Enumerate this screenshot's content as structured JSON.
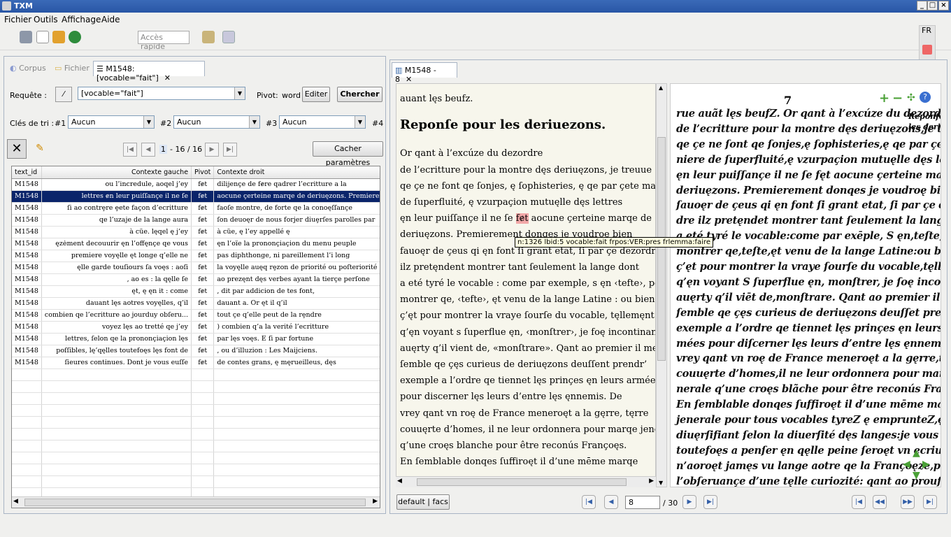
{
  "window": {
    "title": "TXM",
    "controls": [
      "_",
      "□",
      "×"
    ]
  },
  "menu": [
    "Fichier",
    "Outils",
    "Affichage",
    "Aide"
  ],
  "toolbar": {
    "quick_access_placeholder": "Accès rapide"
  },
  "lang": {
    "code": "FR"
  },
  "left_tabs": {
    "corpus": "Corpus",
    "fichier": "Fichier",
    "conc": "M1548:[vocable=\"fait\"]"
  },
  "query": {
    "label": "Requête :",
    "value": "[vocable=\"fait\"]",
    "pivot_label": "Pivot:",
    "pivot_value": "word",
    "edit": "Editer",
    "search": "Chercher"
  },
  "sort": {
    "label": "Clés de tri :",
    "k1": "#1",
    "k2": "#2",
    "k3": "#3",
    "k4": "#4",
    "v1": "Aucun",
    "v2": "Aucun",
    "v3": "Aucun"
  },
  "pager": {
    "current": "1",
    "total": "- 16 / 16",
    "hide": "Cacher paramètres"
  },
  "columns": [
    "text_id",
    "Contexte gauche",
    "Pivot",
    "Contexte droit"
  ],
  "rows": [
    [
      "M1548",
      "ou l’incredule, aoqel j’ey",
      "fɇt",
      "dilijençe de fɇre qadrer l’ecritture a la"
    ],
    [
      "M1548",
      "lettres ɇn leur puiſſançe il ne ſe",
      "fɇt",
      "aocune çerteine marqe de deriuęzons. Premiereme"
    ],
    [
      "M1548",
      "ſi ao contrȩre ȩete façon d’ecritture",
      "fɇt",
      "faoſe montre, de forte qe la conoęſſançe"
    ],
    [
      "M1548",
      "qe l’uzaje de la lange aura",
      "fɇt",
      "ſon deuoęr de nous forjer diuȩrſes parolles par"
    ],
    [
      "M1548",
      "à cüe. lęqel ę j’ey",
      "fɇt",
      "à cüe, ę l’ey appellé ę"
    ],
    [
      "M1548",
      "ęzėment decouurir ęn l’offęnçe qe vous",
      "fɇt",
      "ęn l’oïe la prononçiaçion du menu peuple"
    ],
    [
      "M1548",
      "premiere voyęlle ęt longe q’elle ne",
      "fɇt",
      "pas diphthonge, ni pareillement l’i long"
    ],
    [
      "M1548",
      "ęlle garde touſiours ſa voęs : aoſi",
      "fɇt",
      "la voyęlle auęq rȩzon de priorité ou poſteriorité"
    ],
    [
      "M1548",
      ", ao es : la qęlle ſe",
      "fɇt",
      "ao prezęnt dęs verbes ayant la tierçe perſone"
    ],
    [
      "M1548",
      "ęt, ę ęn it : come",
      "fɇt",
      ", dit par addicion de tes font,"
    ],
    [
      "M1548",
      "dauant lęs aotres voyęlles, q’il",
      "fɇt",
      "dauant a. Or ęt il q’il"
    ],
    [
      "M1548",
      "combien qe l’ecritture ao jourduy obſeru...",
      "fɇt",
      "tout çe q’elle peut de la rȩndre"
    ],
    [
      "M1548",
      "voyez lęs ao tretté qe j’ey",
      "fɇt",
      ") combien q’a la verité l’ecritture"
    ],
    [
      "M1548",
      "lettres, ſelon qe la prononçiaçion lęs",
      "fɇt",
      "par lęs voęs. E ſi par fortune"
    ],
    [
      "M1548",
      "poſſibles, lę’qęlles toutefoęs lęs font de",
      "fɇt",
      ", ou d’illuzion : Les Maijciens."
    ],
    [
      "M1548",
      "ſieures continues. Dont je vous euſſe",
      "fɇt",
      "de contes grans, ę męrueilleus, dęs"
    ]
  ],
  "right_tab": {
    "label": "M1548 - 8"
  },
  "text": {
    "first": "auant lęs beufz.",
    "heading": "Reponſe pour les deriuezons.",
    "lines": [
      " Or qant à l’excúze du dezordre",
      "de l’ecritture pour la montre dęs deriuęzons, je treuue",
      "qe çe ne font qe ſonjes, ę ſophisteries, ę qe par çete manier",
      "de ſuperfluité, ę vzurpaçion mutuęlle dęs lettres",
      "ęn leur puiſſançe il ne ſe ",
      "deriuęzons. Premierement donges je voudroę bien",
      "fauoęr de çeus qi ęn font ſi grant etat, ſi par çe dezordre",
      "ilz pretęndent montrer tant ſeulement la lange dont",
      "a eté tyré le vocable : come par exemple, s ęn ‹tefte›, pour",
      "montrer qe, ‹tefte›, ęt venu de la lange Latine : ou bien ſi",
      "ç’ęt pour montrer la vraye ſourſe du vocable, tęllemęnt",
      "q’ęn voyant s ſuperflue ęn, ‹monſtrer›, je foę incontinant",
      "auęrty q’il vient de, «monſtrare». Qant ao premier il me",
      "ſemble qe çęs curieus de deriuęzons deuſſent prendr’",
      "exemple a l’ordre qe tiennet lęs prinçes ęn leurs armées",
      "pour discerner lęs leurs d’entre lęs ęnnemis. De",
      "vrey qant vn roę de France meneroęt a la gęrre, tęrre",
      "couuęrte d’homes, il ne leur ordonnera pour marqe jeneral",
      "q’une croęs blanche pour être reconús Françoęs.",
      "En ſemblable donqes ſuffiroęt il d’une mēme marqe"
    ],
    "pivot": "fɇt",
    "after_pivot": " aocune çerteine marqe de"
  },
  "tooltip": "n:1326 lbid:5 vocable:fait frpos:VER:pres frlemma:faire",
  "facs": {
    "page_no": "7",
    "margin": [
      "Reponſe",
      "les deri"
    ],
    "lines": [
      "rue auãt lęs beufZ. Or qant à l’excúze du dezordre",
      "de l’ecritture pour la montre dęs deriuęzons,je treuue",
      "qe çe ne ſont qe ſonjes,ę ſophisteries,ę qe par çete ma-",
      "niere de ſuperfluité,ę vzurpaçion mutuęlle dęs lettres",
      "ęn leur puiſſançe il ne ſe fęt aocune çerteine marqe de",
      "deriuęzons. Premierement donqes je voudroę bien",
      "ſauoęr de çeus qi ęn font ſi grant etat, ſi par çe dezor-",
      "dre ilz pretęndet montrer tant ſeulement la lange dōt",
      "a eté tyré le vocable:come par exēple, S ęn,teſte, pour",
      "montrer qe,teſte,ęt venu de la lange Latine:ou bien ſi",
      "ç’ęt pour montrer la vraye ſourſe du vocable,tęllement",
      "q’ęn voyant S ſuperflue ęn, monſtrer, je ſoę incontinãt",
      "auęrty q’il viēt de,monſtrare. Qant ao premier il me",
      "ſemble qe çęs curieus de deriuęzons deuſſet prendr’",
      "exemple a l’ordre qe tiennet lęs prinçes ęn leurs ar-",
      "mées pour diſcerner lęs leurs d’entre lęs ęnnemis. De",
      "vrey qant vn roę de France meneroęt a la gęrre,tęrre",
      "couuęrte d’homes,il ne leur ordonnera pour marqe je-",
      "nerale q’une croęs blãche pour être reconús Françoęs.",
      "En ſemblable donqes ſuffiroęt il d’une mēme marqe",
      "jenerale pour tous vocables tyreZ ę emprunteZ,ęn la",
      "diuęrſifiant ſelon la diuerſité dęs langes:je vous laiſſe",
      "toutefoęs a penſer ęn qęlle peine ſeroęt vn ecriuein qi",
      "n’aoroęt jamęs vu lange aotre qe la Françoęze,pour",
      "l’obſeruançe d’une tęlle curiozité: qant ao prouſit je"
    ]
  },
  "bottom": {
    "edition": "default | facs",
    "page_value": "8",
    "page_total": "/ 30"
  }
}
